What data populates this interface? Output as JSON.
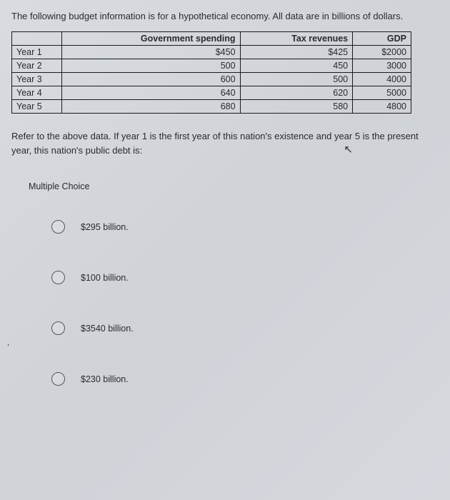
{
  "intro": "The following budget information is for a hypothetical economy. All data are in billions of dollars.",
  "table": {
    "headers": [
      "",
      "Government spending",
      "Tax revenues",
      "GDP"
    ],
    "rows": [
      {
        "label": "Year 1",
        "spending": "$450",
        "tax": "$425",
        "gdp": "$2000"
      },
      {
        "label": "Year 2",
        "spending": "500",
        "tax": "450",
        "gdp": "3000"
      },
      {
        "label": "Year 3",
        "spending": "600",
        "tax": "500",
        "gdp": "4000"
      },
      {
        "label": "Year 4",
        "spending": "640",
        "tax": "620",
        "gdp": "5000"
      },
      {
        "label": "Year 5",
        "spending": "680",
        "tax": "580",
        "gdp": "4800"
      }
    ]
  },
  "question": "Refer to the above data. If year 1 is the first year of this nation's existence and year 5 is the present year, this nation's public debt is:",
  "mc_label": "Multiple Choice",
  "options": [
    "$295 billion.",
    "$100 billion.",
    "$3540 billion.",
    "$230 billion."
  ],
  "cursor": "↖"
}
